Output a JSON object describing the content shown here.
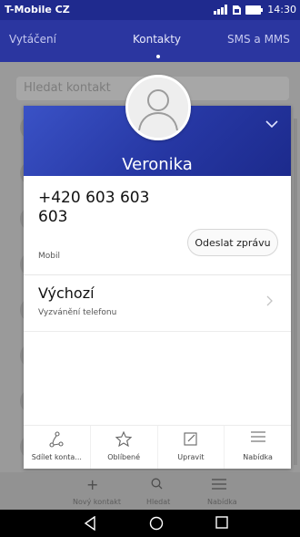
{
  "status_bar": {
    "carrier": "T-Mobile CZ",
    "time": "14:30"
  },
  "tabs": [
    {
      "label": "Vytáčení",
      "selected": false
    },
    {
      "label": "Kontakty",
      "selected": true
    },
    {
      "label": "SMS a MMS",
      "selected": false
    }
  ],
  "search": {
    "placeholder": "Hledat kontakt"
  },
  "background_toolbar": [
    {
      "label": "Nový kontakt",
      "icon": "plus-icon"
    },
    {
      "label": "Hledat",
      "icon": "search-icon"
    },
    {
      "label": "Nabídka",
      "icon": "menu-icon"
    }
  ],
  "contact": {
    "name": "Veronika",
    "phone": "+420 603 603 603",
    "phone_type": "Mobil",
    "send_message_label": "Odeslat zprávu",
    "ringtone_title": "Výchozí",
    "ringtone_subtitle": "Vyzvánění telefonu"
  },
  "card_actions": [
    {
      "label": "Sdílet konta...",
      "icon": "share-icon"
    },
    {
      "label": "Oblíbené",
      "icon": "star-icon"
    },
    {
      "label": "Upravit",
      "icon": "edit-icon"
    },
    {
      "label": "Nabídka",
      "icon": "menu-icon"
    }
  ],
  "colors": {
    "accent": "#2b36a0",
    "status_bar": "#1f2a8e"
  }
}
